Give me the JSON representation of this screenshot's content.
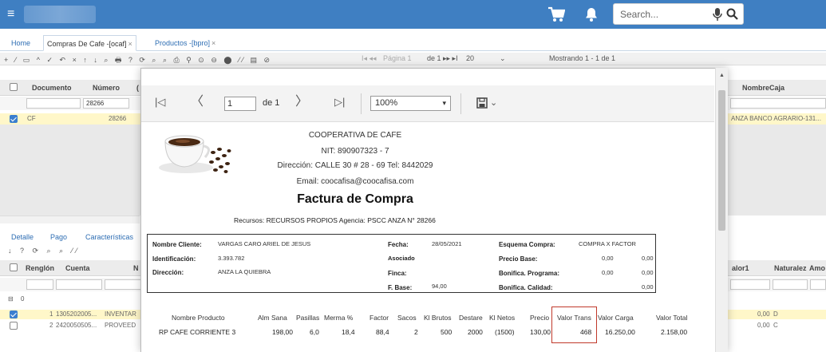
{
  "topbar": {
    "search_placeholder": "Search...",
    "menu_icon": "≡"
  },
  "tabs": [
    {
      "label": "Home"
    },
    {
      "label": "Compras De Cafe -[ocaf]",
      "close": "×"
    },
    {
      "label": "Productos -[bpro]",
      "close": "×"
    }
  ],
  "toolbar": {
    "icons": "+ ⁄ ▭ ^ ✓ ↶ × ↑ ↓ ⌕ 🖶 ? ⟳ ⌕ ⌕ ⎙ ⚲ ⊙ ⊖ ⬤ ⁄⁄ ▤ ⊘",
    "pager_first": "I◂ ◂◂",
    "pager_label": "Página 1",
    "pager_of": "de 1 ▸▸ ▸I",
    "pager_size": "20",
    "pager_size_arrow": "⌄",
    "showing": "Mostrando 1 - 1 de 1"
  },
  "grid": {
    "headers": {
      "documento": "Documento",
      "numero": "Número",
      "nombre_caja": "NombreCaja",
      "extra": "("
    },
    "filter_numero": "28266",
    "row": {
      "documento": "CF",
      "numero": "28266",
      "nombre_caja": "ANZA BANCO AGRARIO-131..."
    }
  },
  "subtabs": {
    "detalle": "Detalle",
    "pago": "Pago",
    "caracteristicas": "Características"
  },
  "subtoolbar": {
    "icons": "↓ ? ⟳ ⌕ ⌕ ⁄⁄"
  },
  "subgrid": {
    "headers": {
      "renglon": "Renglón",
      "cuenta": "Cuenta",
      "n": "N",
      "valor1": "alor1",
      "naturalez": "Naturalez",
      "amo": "Amo"
    },
    "group_label": "0",
    "group_icon": "⊟",
    "rows": [
      {
        "renglon": "1",
        "cuenta": "1305202005...",
        "desc": "INVENTAR",
        "valor": "0,00",
        "nat": "D"
      },
      {
        "renglon": "2",
        "cuenta": "2420050505...",
        "desc": "PROVEED",
        "valor": "0,00",
        "nat": "C"
      }
    ]
  },
  "report_toolbar": {
    "first": "|◁",
    "prev": "〈",
    "page_value": "1",
    "page_of": "de 1",
    "next": "〉",
    "last": "▷|",
    "zoom": "100%",
    "zoom_arrow": "▾",
    "save_arrow": "⌄"
  },
  "invoice": {
    "company": "COOPERATIVA DE CAFE",
    "nit": "NIT: 890907323 - 7",
    "address": "Dirección: CALLE 30 # 28 - 69  Tel: 8442029",
    "email": "Email: coocafisa@coocafisa.com",
    "title": "Factura de Compra",
    "subtitle": "Recursos: RECURSOS PROPIOS  Agencia: PSCC ANZA  N° 28266",
    "customer": {
      "nombre_label": "Nombre Cliente:",
      "nombre": "VARGAS CARO ARIEL DE JESUS",
      "ident_label": "Identificación:",
      "ident": "3.393.782",
      "direccion_label": "Dirección:",
      "direccion": "ANZA LA QUIEBRA",
      "fecha_label": "Fecha:",
      "fecha": "28/05/2021",
      "asociado_label": "Asociado",
      "finca_label": "Finca:",
      "fbase_label": "F. Base:",
      "fbase": "94,00",
      "esquema_label": "Esquema Compra:",
      "esquema": "COMPRA X FACTOR",
      "precio_base_label": "Precio Base:",
      "precio_base_1": "0,00",
      "precio_base_2": "0,00",
      "bon_prog_label": "Bonifica. Programa:",
      "bon_prog_1": "0,00",
      "bon_prog_2": "0,00",
      "bon_cal_label": "Bonifica. Calidad:",
      "bon_cal": "0,00"
    },
    "items_headers": [
      "Nombre Producto",
      "Alm Sana",
      "Pasillas",
      "Merma %",
      "Factor",
      "Sacos",
      "Kl Brutos",
      "Destare",
      "Kl Netos",
      "Precio",
      "Valor Trans",
      "Valor Carga",
      "Valor Total"
    ],
    "items": [
      [
        "RP CAFE CORRIENTE 3",
        "198,00",
        "6,0",
        "18,4",
        "88,4",
        "2",
        "500",
        "2000",
        "(1500)",
        "130,00",
        "468",
        "16.250,00",
        "2.158,00"
      ]
    ]
  },
  "colors": {
    "topbar": "#3f7fc2",
    "highlight": "#c0392b",
    "selected_row": "#fff7c9"
  }
}
